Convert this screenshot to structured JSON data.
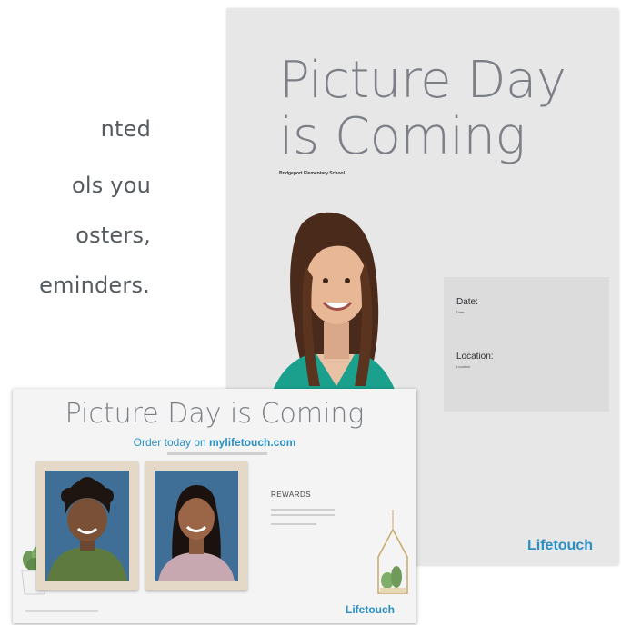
{
  "intro": {
    "lines": [
      ":",
      "nted",
      "ols you",
      "osters,",
      "eminders."
    ]
  },
  "poster": {
    "title_line1": "Picture Day",
    "title_line2": "is Coming",
    "subtitle": "Bridgeport Elementary School",
    "date_label": "Date:",
    "date_value": "Date",
    "location_label": "Location:",
    "location_value": "Location",
    "logo": "Lifetouch"
  },
  "flyer": {
    "title": "Picture Day is Coming",
    "order_prefix": "Order today on ",
    "order_site": "mylifetouch.com",
    "rewards": "REWARDS",
    "logo": "Lifetouch"
  },
  "colors": {
    "brand_blue": "#2a8fc4",
    "title_gray": "#7c8086",
    "poster_bg": "#e7e7e8"
  }
}
